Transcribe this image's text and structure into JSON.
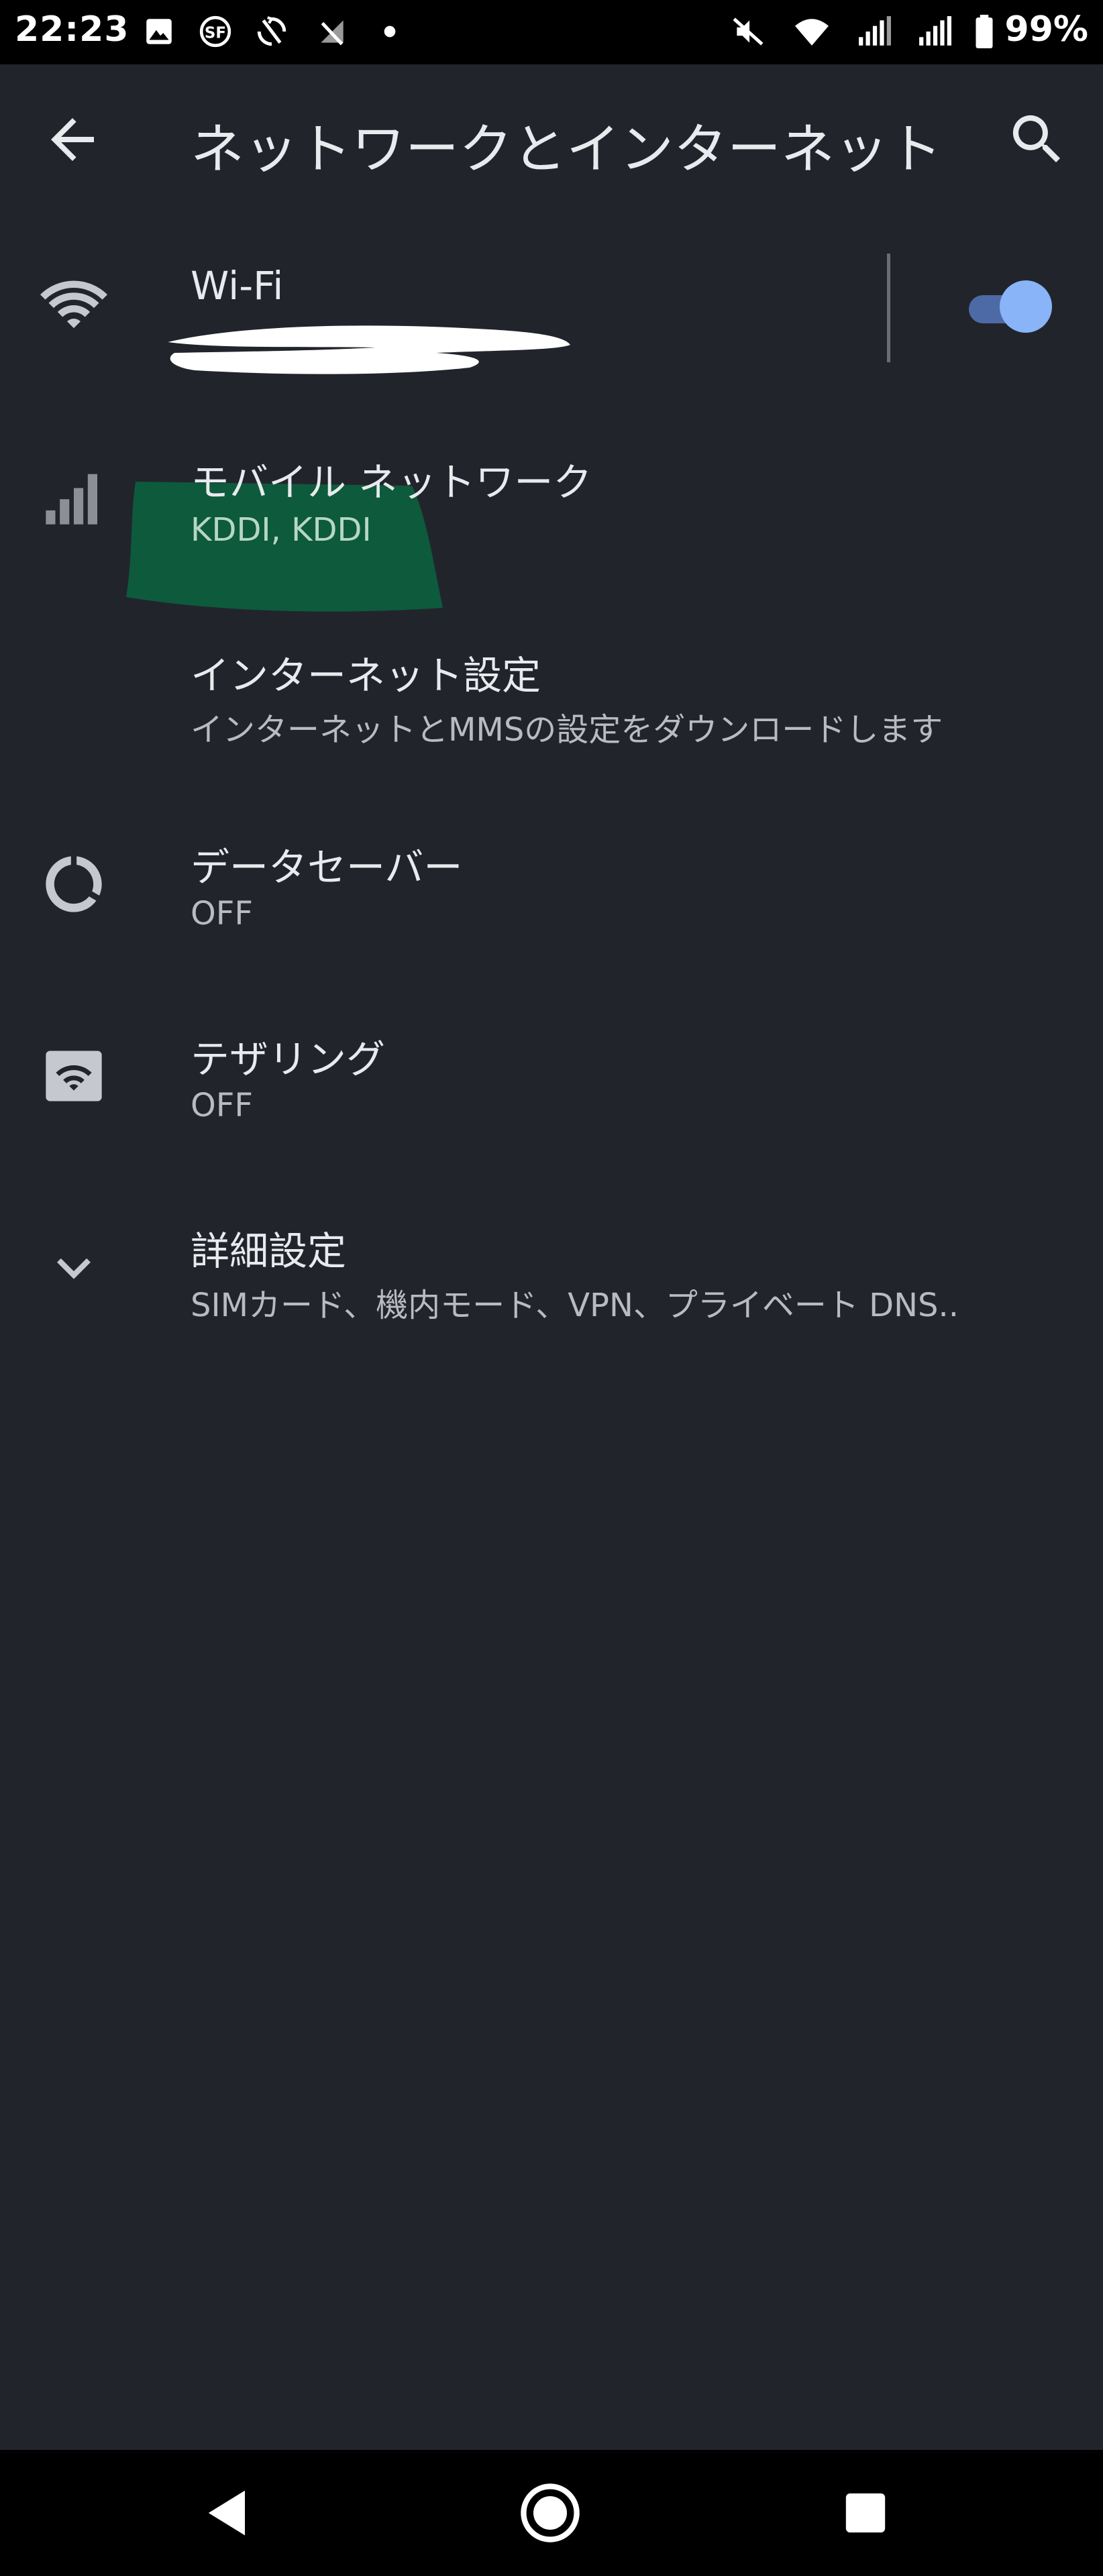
{
  "status_bar": {
    "time": "22:23",
    "battery_percent": "99%",
    "left_icons": [
      "image-icon",
      "sf-app-icon",
      "sync-off-icon",
      "no-signal-icon",
      "dot-icon"
    ],
    "right_icons": [
      "mute-icon",
      "wifi-icon",
      "signal-icon",
      "signal-icon-2",
      "battery-icon"
    ]
  },
  "app_bar": {
    "title": "ネットワークとインターネット",
    "back_icon": "arrow-back-icon",
    "search_icon": "search-icon"
  },
  "items": [
    {
      "title": "Wi-Fi",
      "summary": "",
      "icon": "wifi-icon",
      "toggle_on": true
    },
    {
      "title": "モバイル ネットワーク",
      "summary": "KDDI, KDDI",
      "icon": "signal-bars-icon"
    },
    {
      "title": "インターネット設定",
      "summary": "インターネットとMMSの設定をダウンロードします",
      "icon": ""
    },
    {
      "title": "データセーバー",
      "summary": "OFF",
      "icon": "data-saver-icon"
    },
    {
      "title": "テザリング",
      "summary": "OFF",
      "icon": "hotspot-icon"
    },
    {
      "title": "詳細設定",
      "summary": "SIMカード、機内モード、VPN、プライベート DNS..",
      "icon": "chevron-down-icon"
    }
  ],
  "colors": {
    "background": "#21252b",
    "bars": "#000000",
    "accent": "#8ab4f8",
    "redaction_green": "#0d5a3c"
  },
  "nav_bar": {
    "buttons": [
      "back-triangle-icon",
      "home-circle-icon",
      "recents-square-icon"
    ]
  }
}
